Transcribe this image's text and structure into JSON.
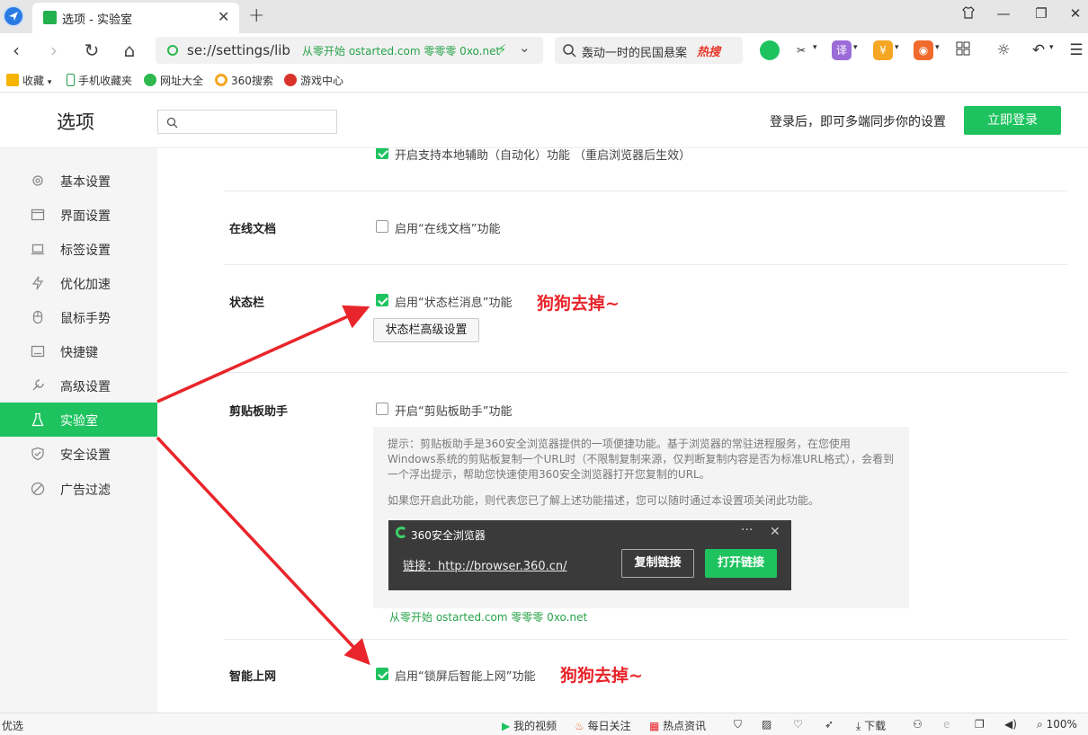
{
  "tab": {
    "title": "选项 - 实验室",
    "close": "✕",
    "new": "+"
  },
  "window": {
    "shirt": "",
    "minimize": "—",
    "restore": "❐",
    "close": "✕"
  },
  "nav": {
    "back": "‹",
    "forward": "›",
    "reload": "↻",
    "home": "⌂",
    "url": "se://settings/lib",
    "url_promo": "从零开始 ostarted.com 零零零 0xo.net",
    "search_text": "轰动一时的民国悬案",
    "hot": "热搜"
  },
  "toolbar": {
    "translate": "译",
    "colors": {
      "wechat": "#1ec35f",
      "translate": "#9b6cd8",
      "coupon": "#f5a623",
      "game": "#f06a2d"
    }
  },
  "bookmarks": [
    {
      "label": "收藏"
    },
    {
      "label": "手机收藏夹"
    },
    {
      "label": "网址大全"
    },
    {
      "label": "360搜索"
    },
    {
      "label": "游戏中心"
    }
  ],
  "header": {
    "title": "选项",
    "search_placeholder": "",
    "login_hint": "登录后，即可多端同步你的设置",
    "login_button": "立即登录"
  },
  "sidebar": {
    "items": [
      {
        "label": "基本设置",
        "icon": "gear-icon"
      },
      {
        "label": "界面设置",
        "icon": "window-icon"
      },
      {
        "label": "标签设置",
        "icon": "tab-icon"
      },
      {
        "label": "优化加速",
        "icon": "bolt-icon"
      },
      {
        "label": "鼠标手势",
        "icon": "mouse-icon"
      },
      {
        "label": "快捷键",
        "icon": "keyboard-icon"
      },
      {
        "label": "高级设置",
        "icon": "wrench-icon"
      },
      {
        "label": "实验室",
        "icon": "flask-icon",
        "active": true
      },
      {
        "label": "安全设置",
        "icon": "shield-icon"
      },
      {
        "label": "广告过滤",
        "icon": "block-icon"
      }
    ]
  },
  "content": {
    "automation": {
      "label": "开启支持本地辅助（自动化）功能 （重启浏览器后生效）",
      "checked": true
    },
    "online_docs": {
      "title": "在线文档",
      "label": "启用“在线文档”功能",
      "checked": false
    },
    "status_bar": {
      "title": "状态栏",
      "label": "启用“状态栏消息”功能",
      "checked": true,
      "annotation": "狗狗去掉~",
      "button": "状态栏高级设置"
    },
    "clipboard": {
      "title": "剪贴板助手",
      "label": "开启“剪贴板助手”功能",
      "checked": false,
      "hint": "提示：剪贴板助手是360安全浏览器提供的一项便捷功能。基于浏览器的常驻进程服务，在您使用Windows系统的剪贴板复制一个URL时（不限制复制来源，仅判断复制内容是否为标准URL格式），会看到一个浮出提示，帮助您快速使用360安全浏览器打开您复制的URL。",
      "hint2": "如果您开启此功能，则代表您已了解上述功能描述，您可以随时通过本设置项关闭此功能。",
      "popup": {
        "title": "360安全浏览器",
        "more": "···",
        "close": "✕",
        "link": "链接：http://browser.360.cn/",
        "copy_button": "复制链接",
        "open_button": "打开链接"
      },
      "promo": "从零开始 ostarted.com 零零零 0xo.net"
    },
    "smart_net": {
      "title": "智能上网",
      "label": "启用“锁屏后智能上网”功能",
      "checked": true,
      "annotation": "狗狗去掉~"
    }
  },
  "statusbar": {
    "left": "优选",
    "my_video": "我的视频",
    "daily": "每日关注",
    "hot_news": "热点资讯",
    "download": "下载",
    "zoom": "100%"
  }
}
